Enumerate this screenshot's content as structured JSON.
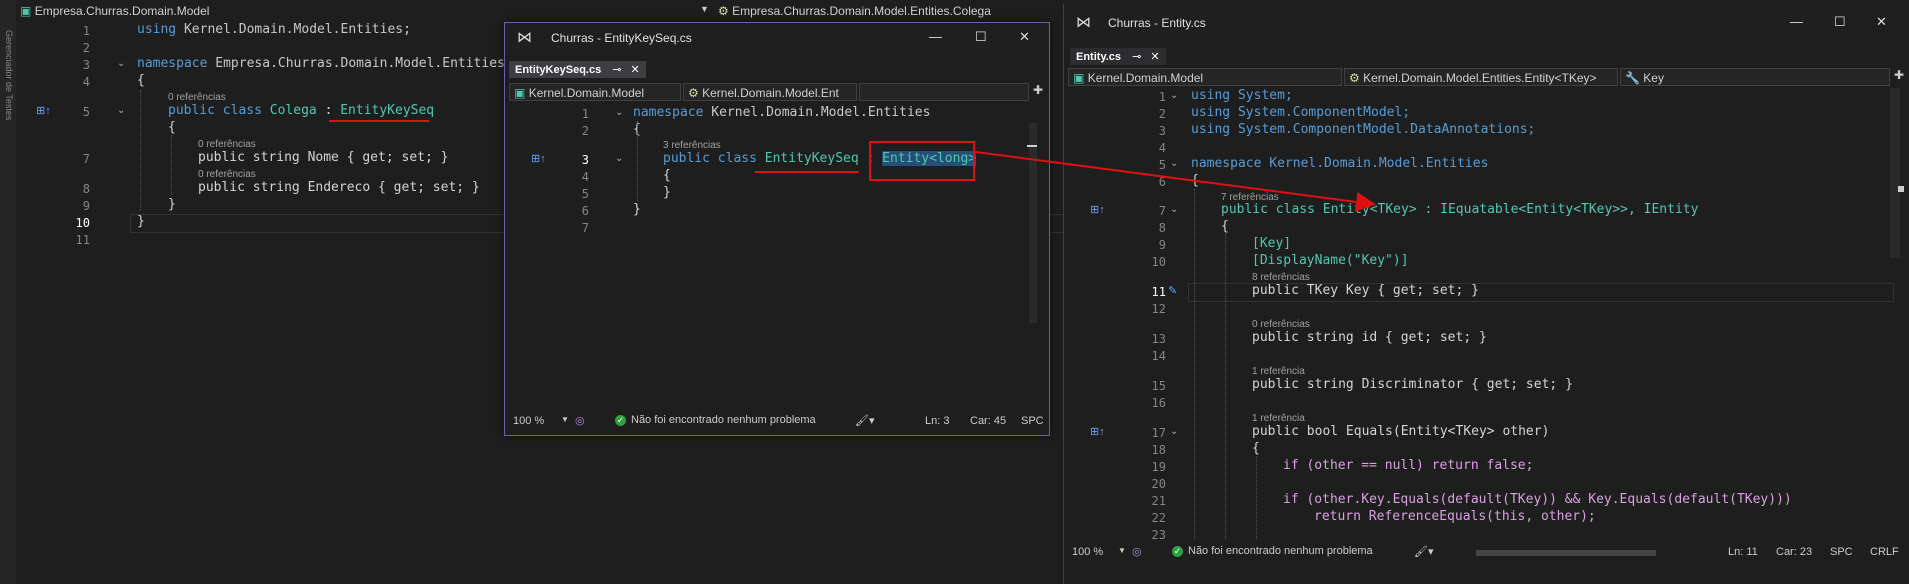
{
  "left": {
    "nav_project": "Empresa.Churras.Domain.Model",
    "nav_class": "Empresa.Churras.Domain.Model.Entities.Colega",
    "side_label": "Gerenciador de Testes",
    "ln": [
      "1",
      "2",
      "3",
      "4",
      "5",
      "7",
      "8",
      "9",
      "10",
      "11"
    ],
    "refs": [
      "0 referências",
      "0 referências",
      "0 referências"
    ],
    "l1_using": "using",
    "l1_ns": "Kernel.Domain.Model.Entities",
    "l3_kw": "namespace",
    "l3_ns": "Empresa.Churras.Domain.Model.Entities",
    "brace_open": "{",
    "brace_close": "}",
    "l5_public": "public",
    "l5_class": "class",
    "l5_name": "Colega",
    "l5_colon": ":",
    "l5_base": "EntityKeySeq",
    "l7_code": "public string Nome { get; set; }",
    "l8_code": "public string Endereco { get; set; }"
  },
  "mid": {
    "title": "Churras - EntityKeySeq.cs",
    "tab": "EntityKeySeq.cs",
    "nav_project": "Kernel.Domain.Model",
    "nav_class": "Kernel.Domain.Model.Ent",
    "ln": [
      "1",
      "2",
      "3",
      "4",
      "5",
      "6",
      "7"
    ],
    "refs": "3 referências",
    "l1_kw": "namespace",
    "l1_ns": "Kernel.Domain.Model.Entities",
    "l3_public": "public",
    "l3_class": "class",
    "l3_name": "EntityKeySeq",
    "l3_colon": ":",
    "l3_base": "Entity<long>",
    "zoom": "100 %",
    "status_msg": "Não foi encontrado nenhum problema",
    "line_col": "Ln: 3",
    "char_col": "Car: 45",
    "enc": "SPC"
  },
  "right": {
    "title": "Churras - Entity.cs",
    "tab": "Entity.cs",
    "nav_project": "Kernel.Domain.Model",
    "nav_class": "Kernel.Domain.Model.Entities.Entity<TKey>",
    "nav_member": "Key",
    "ln": [
      "1",
      "2",
      "3",
      "4",
      "5",
      "6",
      "7",
      "8",
      "9",
      "10",
      "11",
      "12",
      "13",
      "14",
      "15",
      "16",
      "17",
      "18",
      "19",
      "20",
      "21",
      "22",
      "23"
    ],
    "refs": [
      "7 referências",
      "8 referências",
      "0 referências",
      "1 referência",
      "1 referência"
    ],
    "code": [
      "using System;",
      "using System.ComponentModel;",
      "using System.ComponentModel.DataAnnotations;",
      "namespace Kernel.Domain.Model.Entities",
      "{",
      "public class Entity<TKey> : IEquatable<Entity<TKey>>, IEntity",
      "{",
      "[Key]",
      "[DisplayName(\"Key\")]",
      "public TKey Key { get; set; }",
      "public string id { get; set; }",
      "public string Discriminator { get; set; }",
      "public bool Equals(Entity<TKey> other)",
      "{",
      "if (other == null) return false;",
      "if (other.Key.Equals(default(TKey)) && Key.Equals(default(TKey)))",
      "return ReferenceEquals(this, other);"
    ],
    "zoom": "100 %",
    "status_msg": "Não foi encontrado nenhum problema",
    "line_col": "Ln: 11",
    "char_col": "Car: 23",
    "enc": "SPC",
    "eol": "CRLF"
  },
  "colors": {
    "accent": "#6c5ea7",
    "annotation": "#dd1111",
    "ok": "#2ea043"
  }
}
